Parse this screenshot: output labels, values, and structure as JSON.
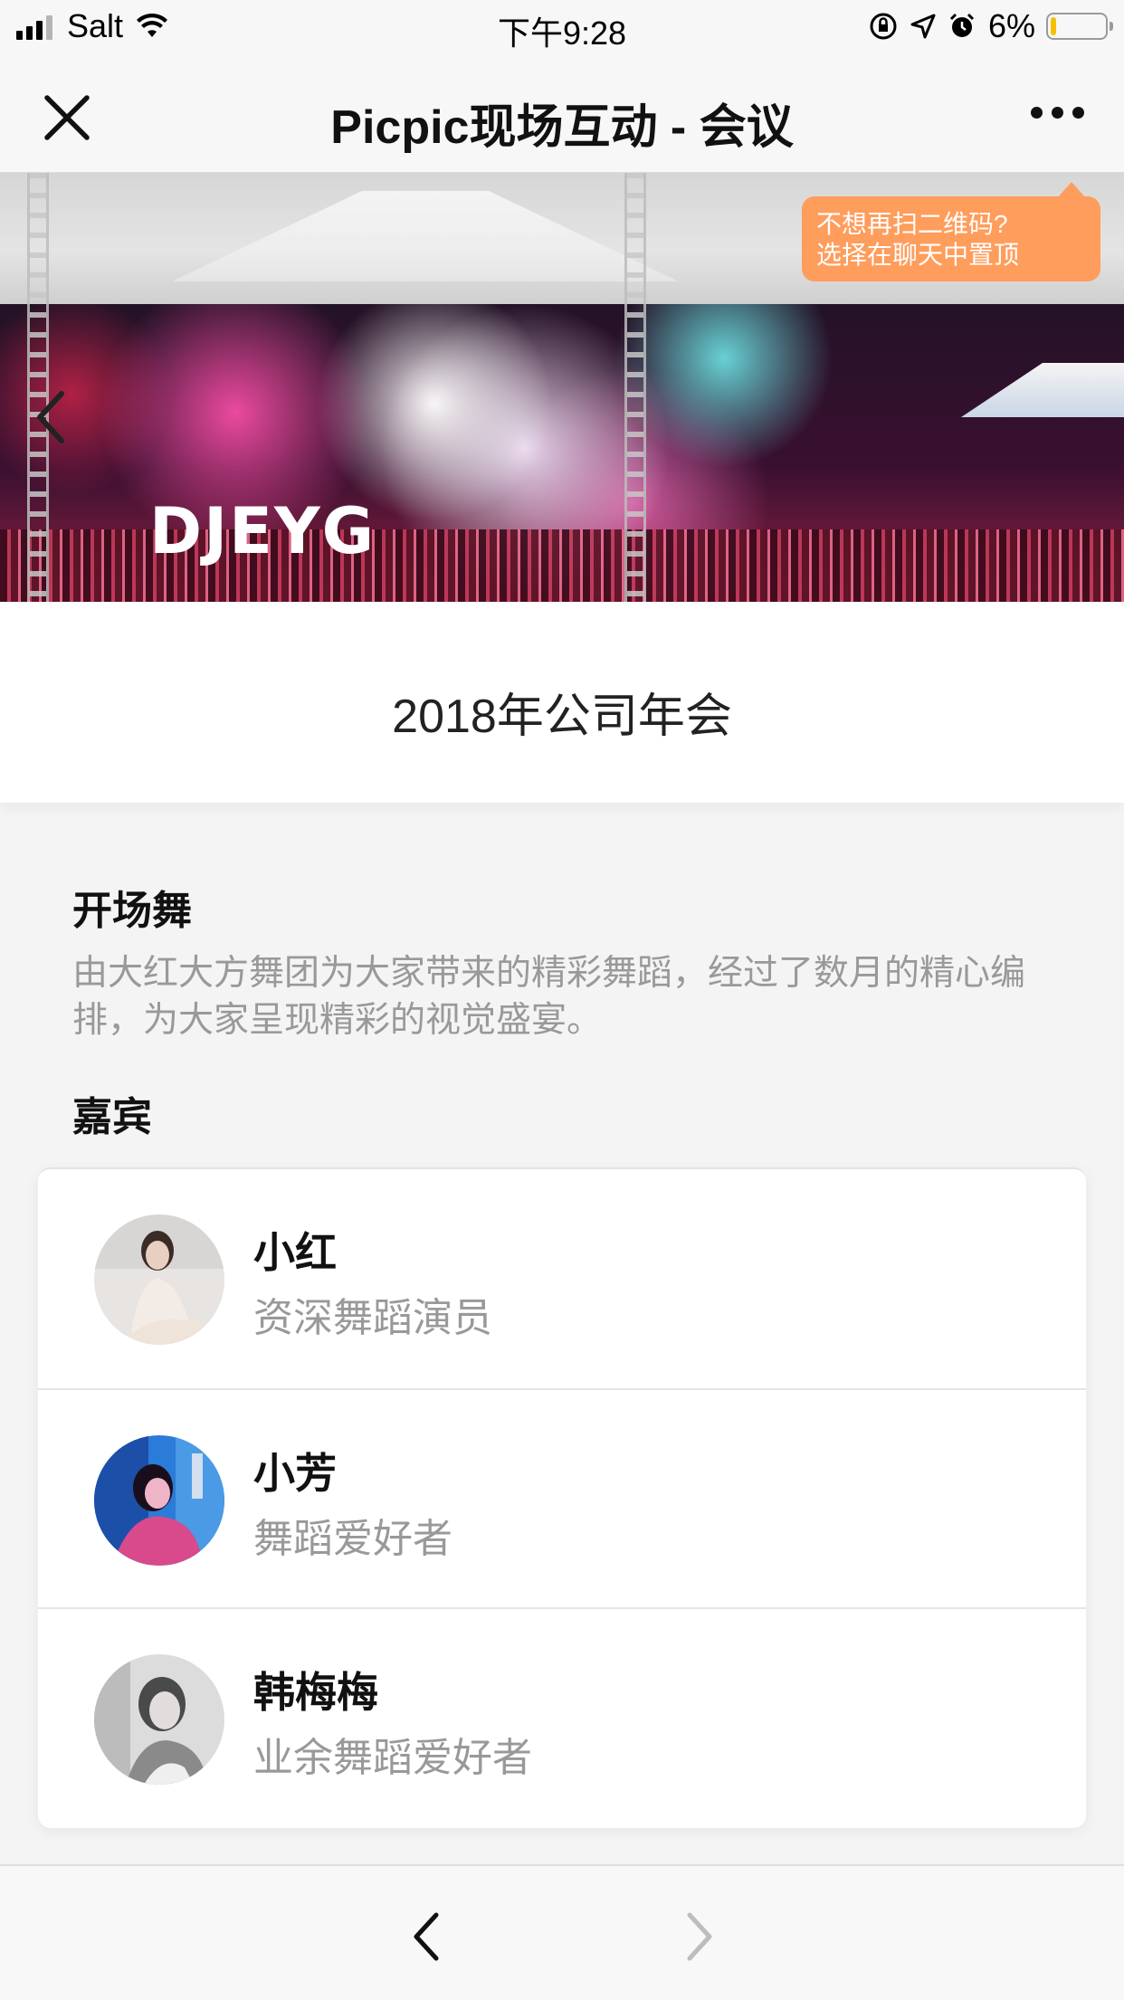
{
  "status_bar": {
    "carrier": "Salt",
    "time": "下午9:28",
    "battery": "6%",
    "battery_level": 0.06
  },
  "nav_bar": {
    "title": "Picpic现场互动 - 会议"
  },
  "banner": {
    "stage_sign": "DJEYG",
    "tooltip_line1": "不想再扫二维码?",
    "tooltip_line2": "选择在聊天中置顶"
  },
  "event": {
    "title": "2018年公司年会"
  },
  "program": {
    "heading": "开场舞",
    "description": "由大红大方舞团为大家带来的精彩舞蹈，经过了数月的精心编排，为大家呈现精彩的视觉盛宴。"
  },
  "guests": {
    "heading": "嘉宾",
    "items": [
      {
        "name": "小红",
        "role": "资深舞蹈演员"
      },
      {
        "name": "小芳",
        "role": "舞蹈爱好者"
      },
      {
        "name": "韩梅梅",
        "role": "业余舞蹈爱好者"
      }
    ]
  },
  "icons": {
    "close": "close-icon",
    "more": "more-icon",
    "back": "chevron-left-icon",
    "forward": "chevron-right-icon"
  },
  "colors": {
    "tooltip": "#ff9d5c",
    "battery": "#f6c000",
    "secondary_text": "#999999"
  }
}
